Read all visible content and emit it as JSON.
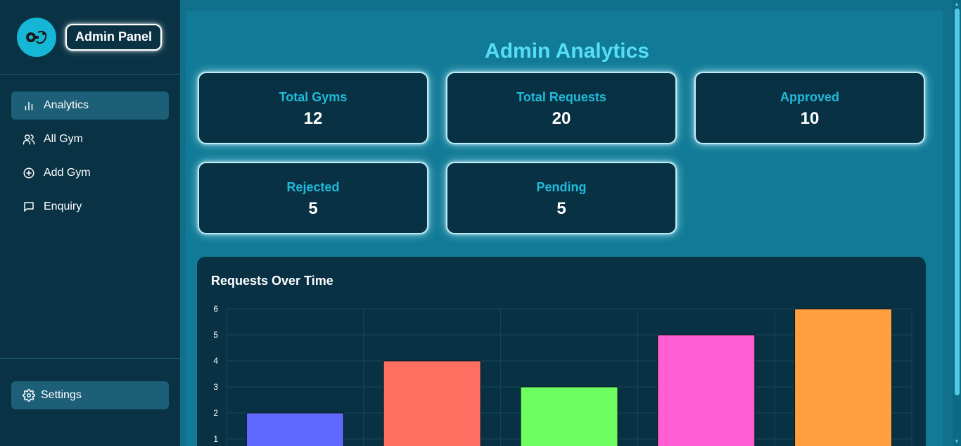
{
  "brand": {
    "title": "Admin Panel"
  },
  "sidebar": {
    "items": [
      {
        "label": "Analytics",
        "icon": "bar-chart-icon",
        "active": true
      },
      {
        "label": "All Gym",
        "icon": "users-icon",
        "active": false
      },
      {
        "label": "Add Gym",
        "icon": "plus-circle-icon",
        "active": false
      },
      {
        "label": "Enquiry",
        "icon": "message-square-icon",
        "active": false
      }
    ],
    "settings_label": "Settings"
  },
  "main": {
    "title": "Admin Analytics",
    "stats": [
      {
        "label": "Total Gyms",
        "value": "12"
      },
      {
        "label": "Total Requests",
        "value": "20"
      },
      {
        "label": "Approved",
        "value": "10"
      },
      {
        "label": "Rejected",
        "value": "5"
      },
      {
        "label": "Pending",
        "value": "5"
      }
    ]
  },
  "colors": {
    "accent": "#56def7",
    "sidebar_bg": "#093244",
    "card_bg": "#083244",
    "bars": [
      "#6068ff",
      "#ff6f61",
      "#6cff5f",
      "#ff5fd2",
      "#ff9f3f"
    ]
  },
  "chart_data": {
    "type": "bar",
    "title": "Requests Over Time",
    "categories": [],
    "values": [
      2,
      4,
      3,
      5,
      6
    ],
    "yticks": [
      1,
      2,
      3,
      4,
      5,
      6
    ],
    "ylim": [
      0,
      6
    ],
    "grid": true
  }
}
